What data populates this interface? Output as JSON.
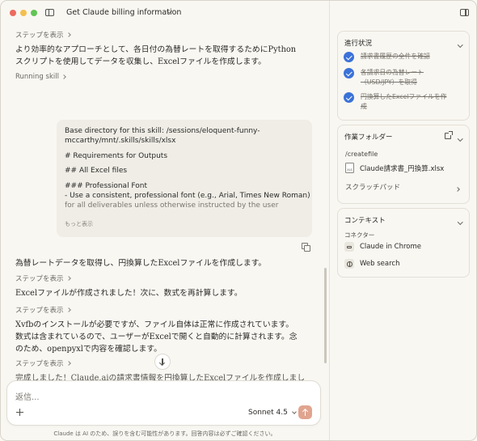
{
  "window": {
    "title": "Get Claude billing information",
    "traffic_lights": [
      "#ec6a5e",
      "#f4bf4f",
      "#61c554"
    ]
  },
  "chat": {
    "step_label": "ステップを表示",
    "para1": "より効率的なアプローチとして、各日付の為替レートを取得するためにPythonスクリプトを使用してデータを収集し、Excelファイルを作成します。",
    "running_skill": "Running skill",
    "code_lines": [
      "Base directory for this skill: /sessions/eloquent-funny-",
      "mccarthy/mnt/.skills/skills/xlsx",
      "# Requirements for Outputs",
      "## All Excel files",
      "### Professional Font",
      "- Use a consistent, professional font (e.g., Arial, Times New Roman)",
      "for all deliverables unless otherwise instructed by the user"
    ],
    "show_more": "もっと表示",
    "para2": "為替レートデータを取得し、円換算したExcelファイルを作成します。",
    "para3": "Excelファイルが作成されました！次に、数式を再計算します。",
    "para4": "Xvfbのインストールが必要ですが、ファイル自体は正常に作成されています。数式は含まれているので、ユーザーがExcelで開くと自動的に計算されます。念のため、openpyxlで内容を確認します。",
    "para5": "完成しました！Claude.aiの請求書情報を円換算したExcelファイルを作成しまし"
  },
  "composer": {
    "placeholder": "返信...",
    "model": "Sonnet 4.5",
    "disclaimer": "Claude は AI のため、誤りを含む可能性があります。回答内容は必ずご確認ください。"
  },
  "panel": {
    "progress": {
      "title": "進行状況",
      "tasks": [
        "請求書履歴の全件を確認",
        "各請求日の為替レート（USD/JPY）を取得",
        "円換算したExcelファイルを作成"
      ]
    },
    "folder": {
      "title": "作業フォルダー",
      "path": "/createfile",
      "file": "Claude請求書_円換算.xlsx",
      "scratchpad": "スクラッチパッド"
    },
    "context": {
      "title": "コンテキスト",
      "connectors_label": "コネクター",
      "connectors": [
        "Claude in Chrome",
        "Web search"
      ]
    }
  },
  "colors": {
    "accent_check": "#3b72d9",
    "send_button": "#e0a48f",
    "background": "#f9f7f2"
  }
}
